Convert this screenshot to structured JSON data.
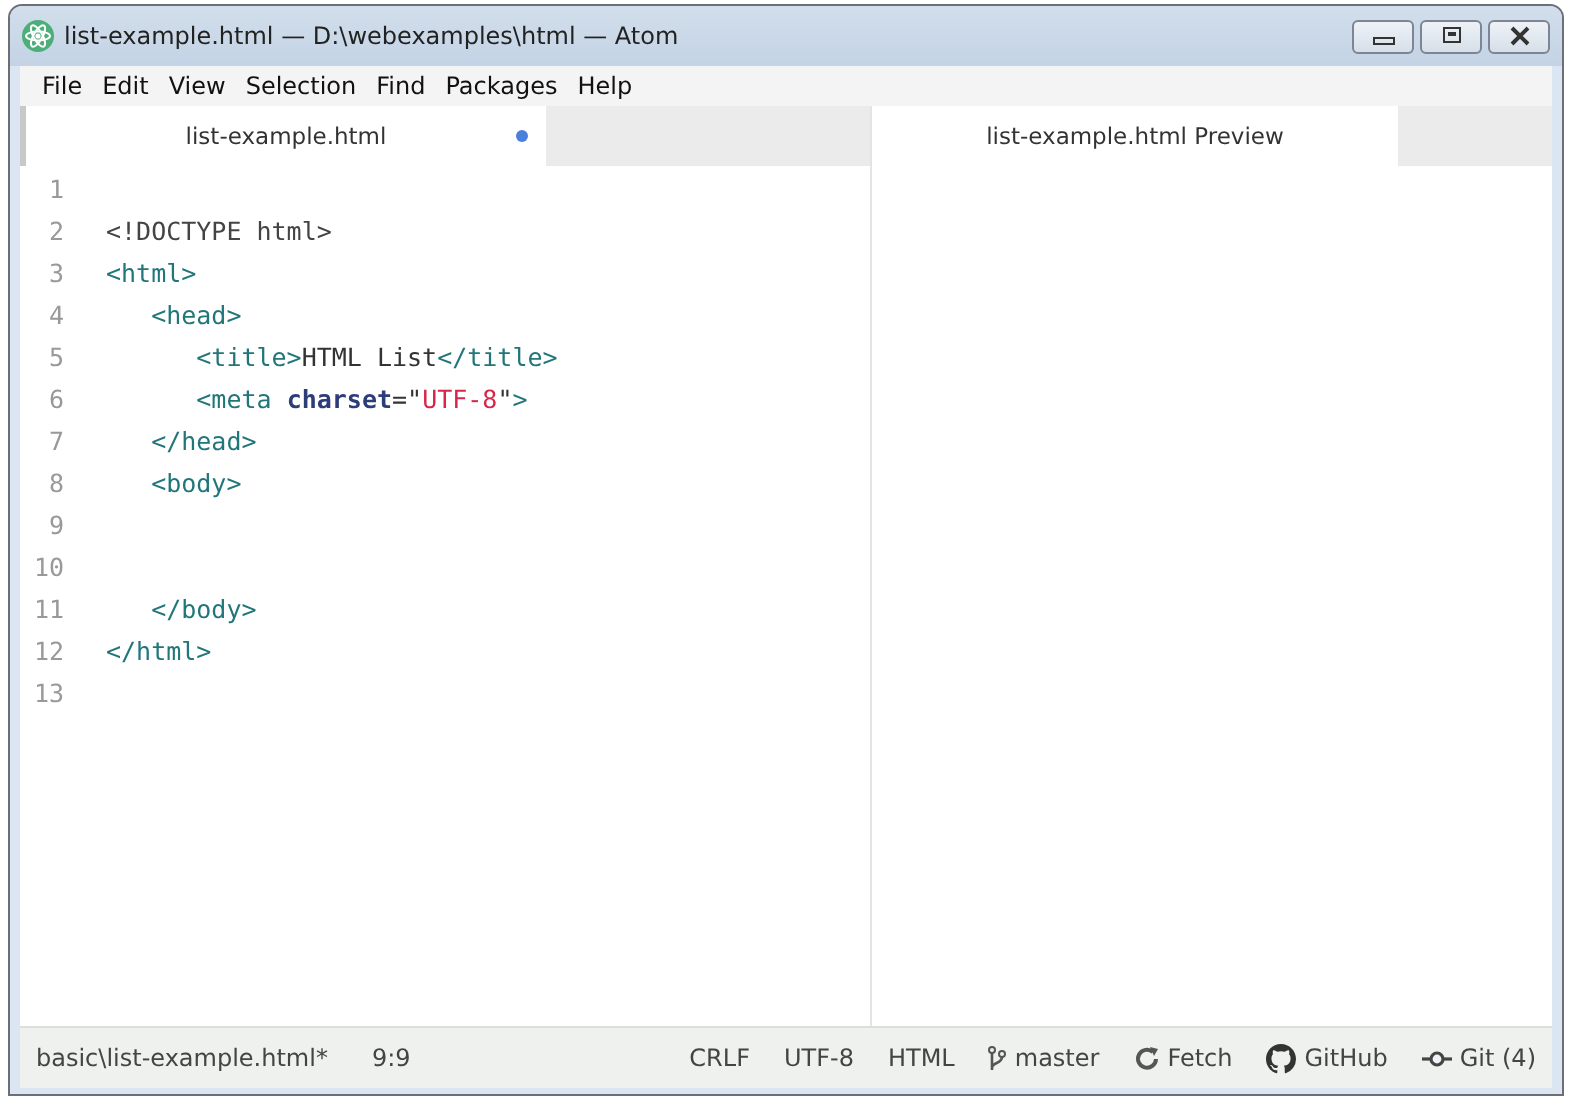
{
  "window": {
    "title": "list-example.html — D:\\webexamples\\html — Atom"
  },
  "menu": [
    "File",
    "Edit",
    "View",
    "Selection",
    "Find",
    "Packages",
    "Help"
  ],
  "panes": [
    {
      "tab": {
        "label": "list-example.html",
        "modified": true
      },
      "lines": [
        {
          "number": "1"
        },
        {
          "number": "2",
          "tokens": [
            {
              "kind": "doctype",
              "text": "<!DOCTYPE html>"
            }
          ]
        },
        {
          "number": "3",
          "tokens": [
            {
              "kind": "tag",
              "text": "<html>"
            }
          ]
        },
        {
          "number": "4",
          "tokens": [
            {
              "kind": "tag",
              "text": "   <head>"
            }
          ]
        },
        {
          "number": "5",
          "tokens": [
            {
              "kind": "tag",
              "text": "      <title>"
            },
            {
              "kind": "text",
              "text": "HTML List"
            },
            {
              "kind": "tag",
              "text": "</title>"
            }
          ]
        },
        {
          "number": "6",
          "tokens": [
            {
              "kind": "tag",
              "text": "      <meta "
            },
            {
              "kind": "attr",
              "text": "charset"
            },
            {
              "kind": "text",
              "text": "=\""
            },
            {
              "kind": "string",
              "text": "UTF-8"
            },
            {
              "kind": "text",
              "text": "\""
            },
            {
              "kind": "tag",
              "text": ">"
            }
          ]
        },
        {
          "number": "7",
          "tokens": [
            {
              "kind": "tag",
              "text": "   </head>"
            }
          ]
        },
        {
          "number": "8",
          "tokens": [
            {
              "kind": "tag",
              "text": "   <body>"
            }
          ]
        },
        {
          "number": "9"
        },
        {
          "number": "10"
        },
        {
          "number": "11",
          "tokens": [
            {
              "kind": "tag",
              "text": "   </body>"
            }
          ]
        },
        {
          "number": "12",
          "tokens": [
            {
              "kind": "tag",
              "text": "</html>"
            }
          ]
        },
        {
          "number": "13"
        }
      ]
    },
    {
      "tab": {
        "label": "list-example.html Preview",
        "modified": false
      }
    }
  ],
  "status_bar": {
    "left": [
      "basic\\list-example.html*",
      "9:9"
    ],
    "right": [
      {
        "kind": "plain",
        "text": "CRLF"
      },
      {
        "kind": "plain",
        "text": "UTF-8"
      },
      {
        "kind": "plain",
        "text": "HTML"
      },
      {
        "kind": "branch",
        "text": "master"
      },
      {
        "kind": "fetch",
        "text": "Fetch"
      },
      {
        "kind": "github",
        "text": "GitHub"
      },
      {
        "kind": "git",
        "text": "Git (4)"
      }
    ]
  }
}
